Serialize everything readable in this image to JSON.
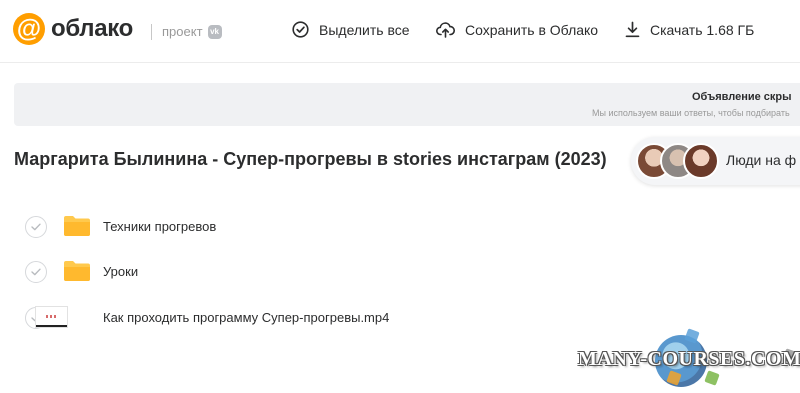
{
  "header": {
    "logo_text": "облако",
    "logo_symbol": "@",
    "project_label": "проект",
    "vk_badge": "vk",
    "select_all": "Выделить все",
    "save_to_cloud": "Сохранить в Облако",
    "download": "Скачать 1.68 ГБ"
  },
  "banner": {
    "title": "Объявление скры",
    "subtitle": "Мы используем ваши ответы, чтобы подбирать"
  },
  "main": {
    "title": "Маргарита Былинина - Супер-прогревы в stories инстаграм (2023)",
    "people_label": "Люди на ф"
  },
  "files": [
    {
      "name": "Техники прогревов",
      "type": "folder"
    },
    {
      "name": "Уроки",
      "type": "folder"
    },
    {
      "name": "Как проходить программу Супер-прогревы.mp4",
      "type": "video"
    }
  ],
  "watermark": "MANY-COURSES.COM",
  "colors": {
    "brand": "#ff9e00",
    "folder": "#ffc94d",
    "text": "#2c2d2e"
  }
}
